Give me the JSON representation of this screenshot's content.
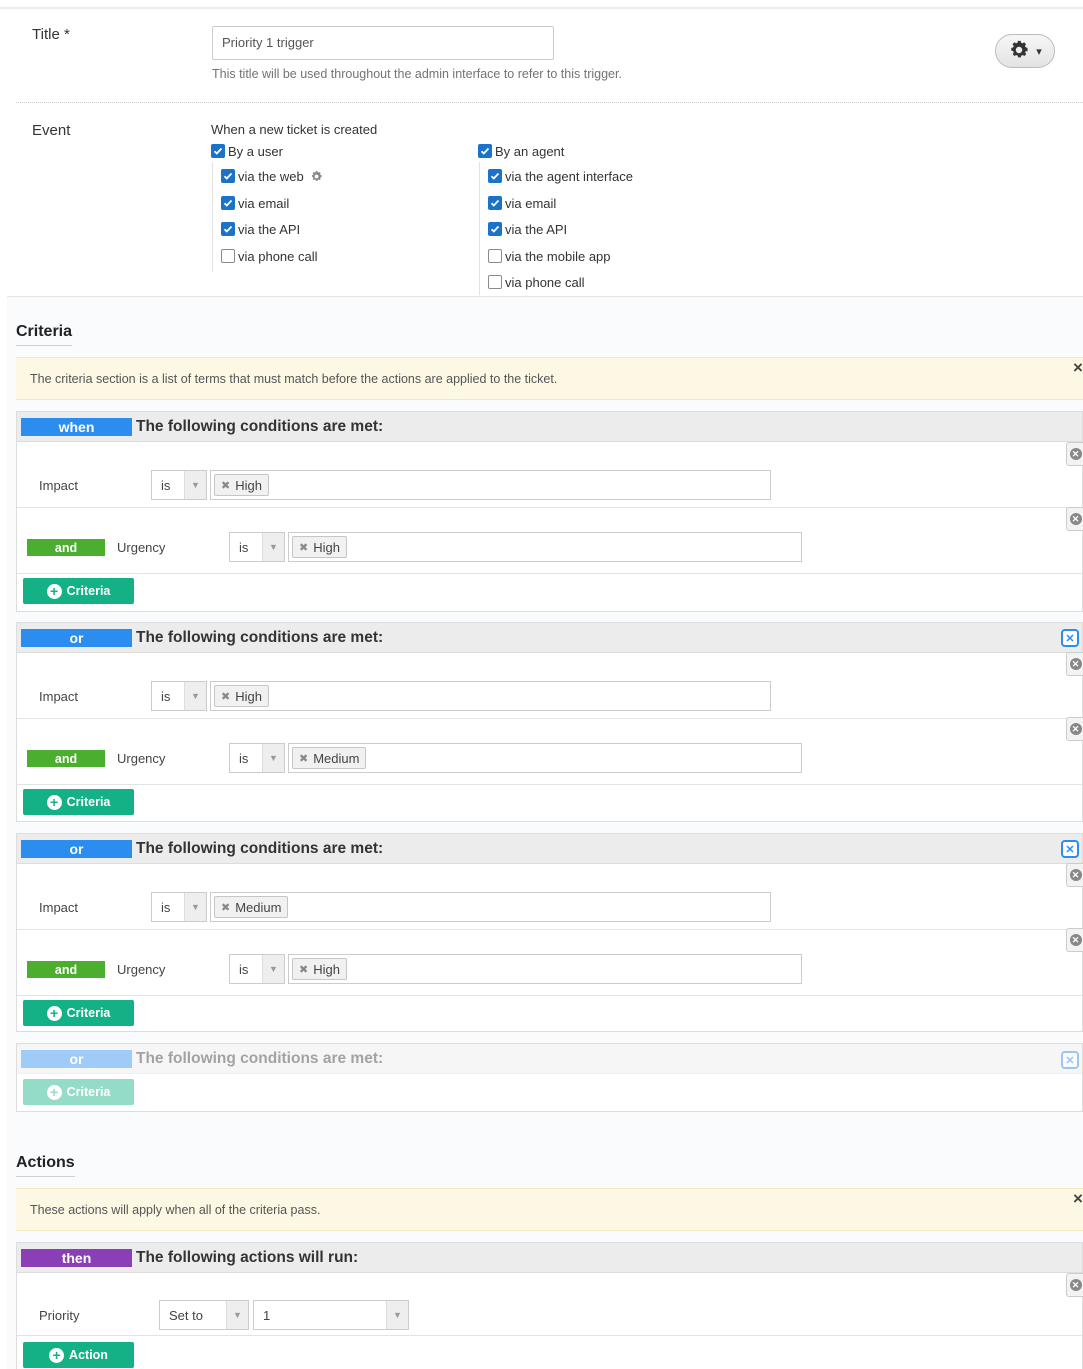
{
  "title_field": {
    "label": "Title *",
    "value": "Priority 1 trigger",
    "help": "This title will be used throughout the admin interface to refer to this trigger."
  },
  "settings_menu": {
    "icon": "gear-icon",
    "caret": "▾"
  },
  "event": {
    "label": "Event",
    "heading": "When a new ticket is created",
    "by_user": {
      "label": "By a user",
      "checked": true,
      "options": [
        {
          "label": "via the web",
          "checked": true
        },
        {
          "label": "via email",
          "checked": true
        },
        {
          "label": "via the API",
          "checked": true
        },
        {
          "label": "via phone call",
          "checked": false
        }
      ]
    },
    "by_agent": {
      "label": "By an agent",
      "checked": true,
      "options": [
        {
          "label": "via the agent interface",
          "checked": true
        },
        {
          "label": "via email",
          "checked": true
        },
        {
          "label": "via the API",
          "checked": true
        },
        {
          "label": "via the mobile app",
          "checked": false
        },
        {
          "label": "via phone call",
          "checked": false
        }
      ]
    }
  },
  "criteria": {
    "title": "Criteria",
    "alert": "The criteria section is a list of terms that must match before the actions are applied to the ticket.",
    "alert_close": "×",
    "groups": [
      {
        "tag": "when",
        "heading": "The following conditions are met:",
        "impact": {
          "label": "Impact",
          "op": "is",
          "token": "High"
        },
        "urgency": {
          "joiner": "and",
          "label": "Urgency",
          "op": "is",
          "token": "High"
        },
        "button": "Criteria"
      },
      {
        "tag": "or",
        "heading": "The following conditions are met:",
        "impact": {
          "label": "Impact",
          "op": "is",
          "token": "High"
        },
        "urgency": {
          "joiner": "and",
          "label": "Urgency",
          "op": "is",
          "token": "Medium"
        },
        "button": "Criteria"
      },
      {
        "tag": "or",
        "heading": "The following conditions are met:",
        "impact": {
          "label": "Impact",
          "op": "is",
          "token": "Medium"
        },
        "urgency": {
          "joiner": "and",
          "label": "Urgency",
          "op": "is",
          "token": "High"
        },
        "button": "Criteria"
      },
      {
        "tag": "or",
        "heading": "The following conditions are met:",
        "button": "Criteria"
      }
    ]
  },
  "actions": {
    "title": "Actions",
    "alert": "These actions will apply when all of the criteria pass.",
    "alert_close": "×",
    "group": {
      "tag": "then",
      "heading": "The following actions will run:",
      "row": {
        "label": "Priority",
        "op": "Set to",
        "value": "1"
      },
      "button": "Action"
    }
  },
  "colors": {
    "tag_blue": "#2c8df0",
    "tag_purple": "#8a3fb7",
    "and_green": "#4cae2f",
    "button_teal": "#14b186",
    "checkbox_blue": "#1a73c8",
    "alert_bg": "#fcf8e3"
  }
}
